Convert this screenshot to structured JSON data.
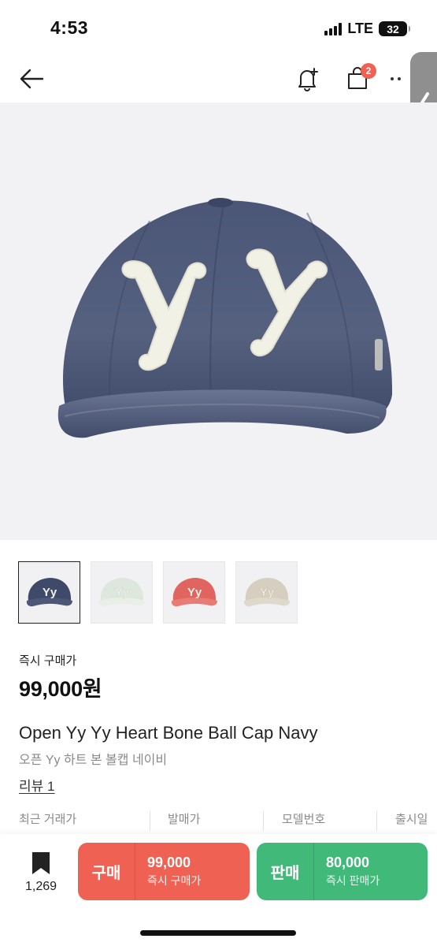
{
  "status_bar": {
    "time": "4:53",
    "network": "LTE",
    "battery": "32"
  },
  "header": {
    "cart_count": "2"
  },
  "product": {
    "price_label": "즉시 구매가",
    "price": "99,000원",
    "title_en": "Open Yy Yy Heart Bone Ball Cap Navy",
    "title_ko": "오픈 Yy 하트 본 볼캡 네이비",
    "review_link": "리뷰 1",
    "hero_letters": "Yy"
  },
  "thumbnails": [
    {
      "letters": "Yy",
      "color": "#3f4a6b",
      "selected": true
    },
    {
      "letters": "Yy",
      "color": "#dfe8df",
      "selected": false
    },
    {
      "letters": "Yy",
      "color": "#e0645f",
      "selected": false
    },
    {
      "letters": "Yy",
      "color": "#d8d1c3",
      "selected": false
    }
  ],
  "info_row": [
    "최근 거래가",
    "발매가",
    "모델번호",
    "출시일"
  ],
  "bottom_bar": {
    "bookmark_count": "1,269",
    "buy": {
      "label": "구매",
      "price": "99,000",
      "sub": "즉시 구매가"
    },
    "sell": {
      "label": "판매",
      "price": "80,000",
      "sub": "즉시 판매가"
    }
  },
  "colors": {
    "buy": "#ef6253",
    "sell": "#41b979",
    "cap_navy": "#47526f",
    "patch": "#f2f1e6"
  }
}
